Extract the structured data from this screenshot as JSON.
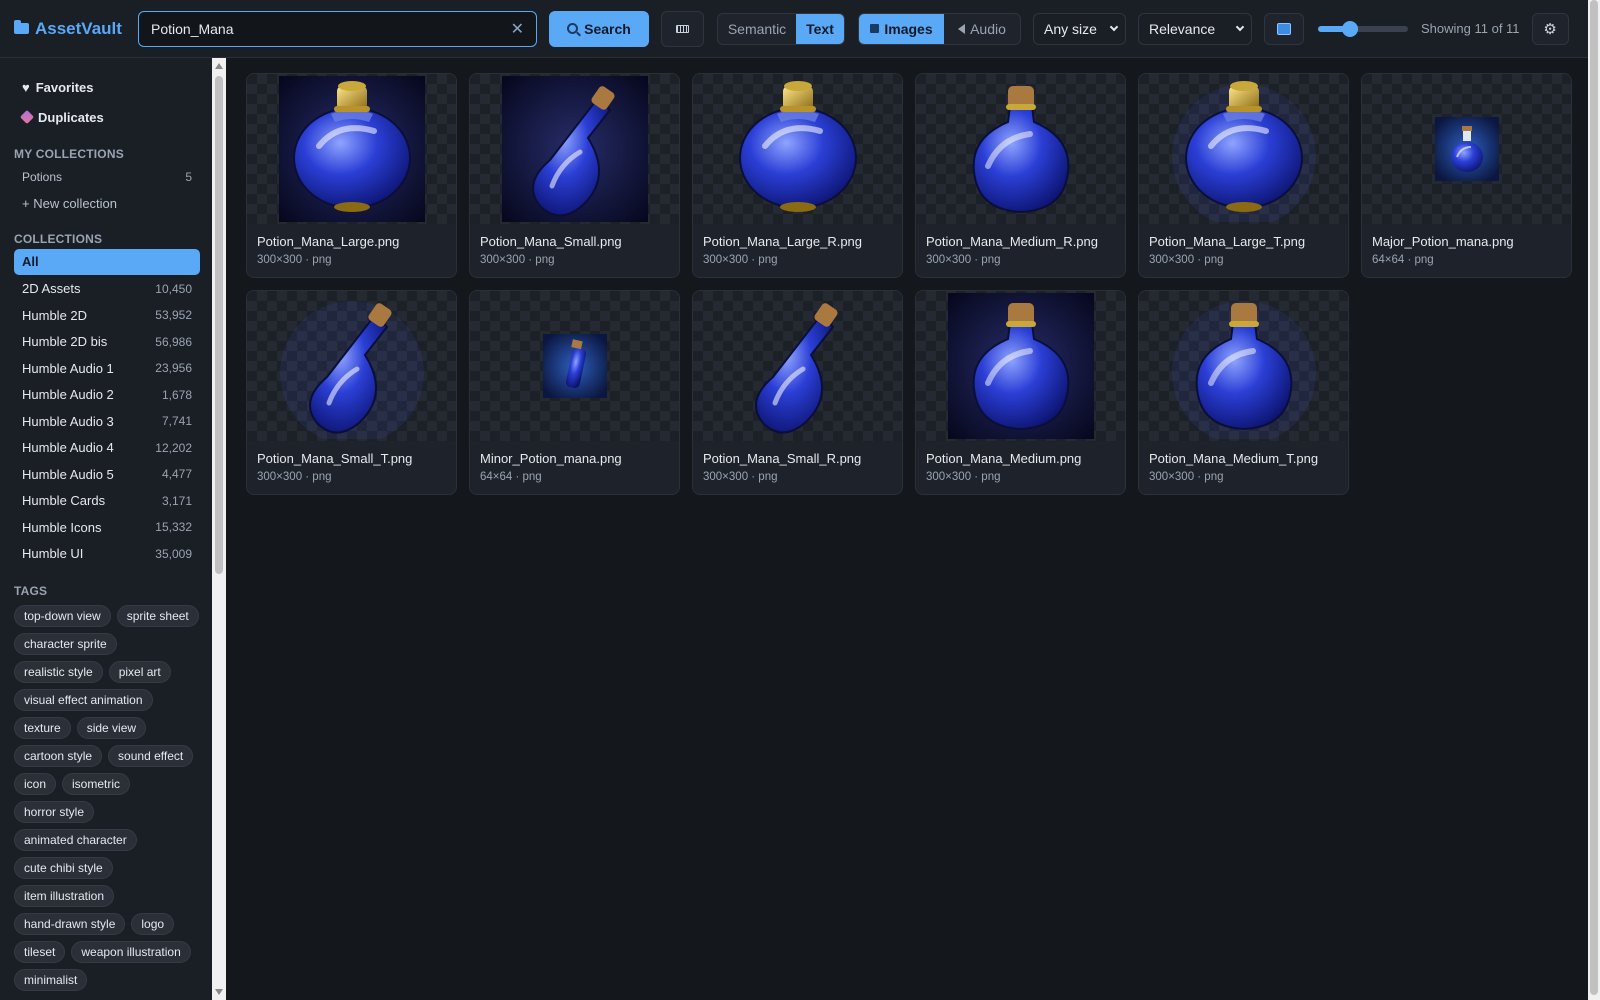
{
  "app": {
    "name": "AssetVault"
  },
  "search": {
    "value": "Potion_Mana",
    "button_label": "Search"
  },
  "mode_toggle": {
    "options": [
      "Semantic",
      "Text"
    ],
    "active": "Text"
  },
  "media_toggle": {
    "options": [
      "Images",
      "Audio"
    ],
    "active": "Images"
  },
  "size_filter": {
    "selected": "Any size"
  },
  "sort": {
    "selected": "Relevance"
  },
  "zoom_slider": {
    "value_fraction": 0.36
  },
  "results": {
    "showing": "Showing 11 of 11"
  },
  "sidebar": {
    "favorites": "Favorites",
    "duplicates": "Duplicates",
    "my_collections_heading": "MY COLLECTIONS",
    "my_collections": [
      {
        "label": "Potions",
        "count": "5"
      }
    ],
    "new_collection": "+ New collection",
    "collections_heading": "COLLECTIONS",
    "collections": [
      {
        "label": "All",
        "count": "",
        "active": true
      },
      {
        "label": "2D Assets",
        "count": "10,450"
      },
      {
        "label": "Humble 2D",
        "count": "53,952"
      },
      {
        "label": "Humble 2D bis",
        "count": "56,986"
      },
      {
        "label": "Humble Audio 1",
        "count": "23,956"
      },
      {
        "label": "Humble Audio 2",
        "count": "1,678"
      },
      {
        "label": "Humble Audio 3",
        "count": "7,741"
      },
      {
        "label": "Humble Audio 4",
        "count": "12,202"
      },
      {
        "label": "Humble Audio 5",
        "count": "4,477"
      },
      {
        "label": "Humble Cards",
        "count": "3,171"
      },
      {
        "label": "Humble Icons",
        "count": "15,332"
      },
      {
        "label": "Humble UI",
        "count": "35,009"
      }
    ],
    "tags_heading": "TAGS",
    "tags": [
      "top-down view",
      "sprite sheet",
      "character sprite",
      "realistic style",
      "pixel art",
      "visual effect animation",
      "texture",
      "side view",
      "cartoon style",
      "sound effect",
      "icon",
      "isometric",
      "horror style",
      "animated character",
      "cute chibi style",
      "item illustration",
      "hand-drawn style",
      "logo",
      "tileset",
      "weapon illustration",
      "minimalist"
    ]
  },
  "assets": [
    {
      "name": "Potion_Mana_Large.png",
      "meta": "300×300 · png",
      "shape": "round",
      "cap": "gold",
      "bg": "dark",
      "icon": "mana-potion-large-icon"
    },
    {
      "name": "Potion_Mana_Small.png",
      "meta": "300×300 · png",
      "shape": "slim",
      "cap": "cork",
      "bg": "dark",
      "icon": "mana-potion-small-icon"
    },
    {
      "name": "Potion_Mana_Large_R.png",
      "meta": "300×300 · png",
      "shape": "round",
      "cap": "gold",
      "bg": "none",
      "icon": "mana-potion-large-icon"
    },
    {
      "name": "Potion_Mana_Medium_R.png",
      "meta": "300×300 · png",
      "shape": "medium",
      "cap": "cork",
      "bg": "none",
      "icon": "mana-potion-medium-icon"
    },
    {
      "name": "Potion_Mana_Large_T.png",
      "meta": "300×300 · png",
      "shape": "round",
      "cap": "gold",
      "bg": "glow",
      "icon": "mana-potion-large-icon"
    },
    {
      "name": "Major_Potion_mana.png",
      "meta": "64×64 · png",
      "shape": "tiny-round",
      "cap": "cork",
      "bg": "tiny",
      "icon": "mana-potion-tiny-icon"
    },
    {
      "name": "Potion_Mana_Small_T.png",
      "meta": "300×300 · png",
      "shape": "slim",
      "cap": "cork",
      "bg": "glow",
      "icon": "mana-potion-small-icon"
    },
    {
      "name": "Minor_Potion_mana.png",
      "meta": "64×64 · png",
      "shape": "tiny-vial",
      "cap": "cork",
      "bg": "tiny",
      "icon": "mana-vial-icon"
    },
    {
      "name": "Potion_Mana_Small_R.png",
      "meta": "300×300 · png",
      "shape": "slim",
      "cap": "cork",
      "bg": "none",
      "icon": "mana-potion-small-icon"
    },
    {
      "name": "Potion_Mana_Medium.png",
      "meta": "300×300 · png",
      "shape": "medium",
      "cap": "cork",
      "bg": "dark",
      "icon": "mana-potion-medium-icon"
    },
    {
      "name": "Potion_Mana_Medium_T.png",
      "meta": "300×300 · png",
      "shape": "medium",
      "cap": "cork",
      "bg": "glow",
      "icon": "mana-potion-medium-icon"
    }
  ],
  "colors": {
    "accent": "#5aa9f7",
    "background": "#14171c",
    "panel": "#1a1e25",
    "potion_blue": "#2b3fd6"
  }
}
